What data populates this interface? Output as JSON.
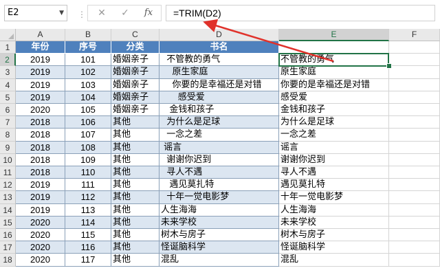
{
  "formula_bar": {
    "name_box": "E2",
    "cancel_icon": "close-icon",
    "enter_icon": "check-icon",
    "fx_label": "fx",
    "formula": "=TRIM(D2)"
  },
  "columns": [
    "A",
    "B",
    "C",
    "D",
    "E",
    "F"
  ],
  "selected_cell": "E2",
  "header_row": {
    "year": "年份",
    "num": "序号",
    "category": "分类",
    "title": "书名"
  },
  "rows": [
    {
      "r": "1"
    },
    {
      "r": "2",
      "year": "2019",
      "num": "101",
      "cat": "婚姻亲子",
      "d": "  不管教的勇气",
      "e": "不管教的勇气"
    },
    {
      "r": "3",
      "year": "2019",
      "num": "102",
      "cat": "婚姻亲子",
      "d": "    原生家庭",
      "e": "原生家庭"
    },
    {
      "r": "4",
      "year": "2019",
      "num": "103",
      "cat": "婚姻亲子",
      "d": "    你要的是幸福还是对错",
      "e": "你要的是幸福还是对错"
    },
    {
      "r": "5",
      "year": "2019",
      "num": "104",
      "cat": "婚姻亲子",
      "d": "      感受爱",
      "e": "感受爱"
    },
    {
      "r": "6",
      "year": "2020",
      "num": "105",
      "cat": "婚姻亲子",
      "d": "   金钱和孩子",
      "e": "金钱和孩子"
    },
    {
      "r": "7",
      "year": "2018",
      "num": "106",
      "cat": "其他",
      "d": "  为什么是足球",
      "e": "为什么是足球"
    },
    {
      "r": "8",
      "year": "2018",
      "num": "107",
      "cat": "其他",
      "d": "  一念之差",
      "e": "一念之差"
    },
    {
      "r": "9",
      "year": "2018",
      "num": "108",
      "cat": "其他",
      "d": " 谣言",
      "e": "谣言"
    },
    {
      "r": "10",
      "year": "2018",
      "num": "109",
      "cat": "其他",
      "d": "  谢谢你迟到",
      "e": "谢谢你迟到"
    },
    {
      "r": "11",
      "year": "2018",
      "num": "110",
      "cat": "其他",
      "d": "  寻人不遇",
      "e": "寻人不遇"
    },
    {
      "r": "12",
      "year": "2019",
      "num": "111",
      "cat": "其他",
      "d": "   遇见莫扎特",
      "e": "遇见莫扎特"
    },
    {
      "r": "13",
      "year": "2019",
      "num": "112",
      "cat": "其他",
      "d": "  十年一觉电影梦",
      "e": "十年一觉电影梦"
    },
    {
      "r": "14",
      "year": "2019",
      "num": "113",
      "cat": "其他",
      "d": "人生海海",
      "e": "人生海海"
    },
    {
      "r": "15",
      "year": "2020",
      "num": "114",
      "cat": "其他",
      "d": "未来学校",
      "e": "未来学校"
    },
    {
      "r": "16",
      "year": "2020",
      "num": "115",
      "cat": "其他",
      "d": "树木与房子",
      "e": "树木与房子"
    },
    {
      "r": "17",
      "year": "2020",
      "num": "116",
      "cat": "其他",
      "d": "怪诞脑科学",
      "e": "怪诞脑科学"
    },
    {
      "r": "18",
      "year": "2020",
      "num": "117",
      "cat": "其他",
      "d": "混乱",
      "e": "混乱"
    }
  ],
  "colors": {
    "header_fill": "#4f81bd",
    "band_fill": "#dce6f1",
    "selection": "#217346",
    "arrow": "#e0322b"
  }
}
